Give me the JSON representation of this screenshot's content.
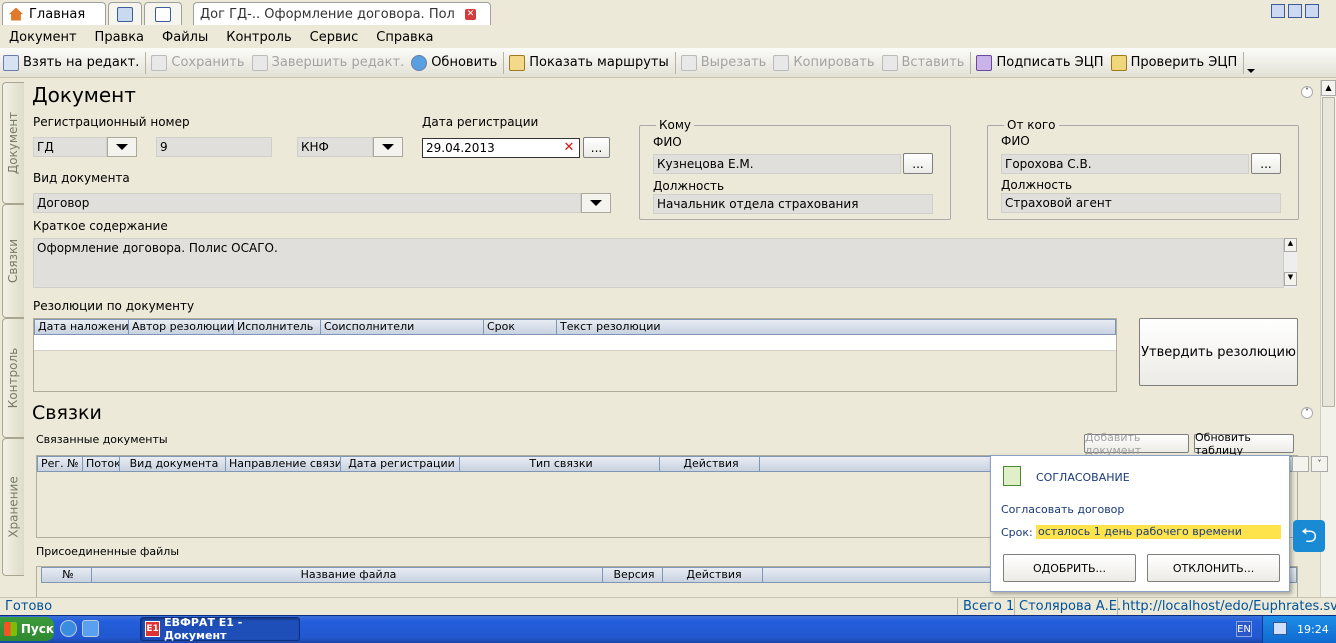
{
  "tabs": [
    {
      "label": "Главная"
    },
    {
      "label": ""
    },
    {
      "label": ""
    },
    {
      "label": "Дог ГД-..  Оформление договора. Полис..."
    }
  ],
  "menu": [
    "Документ",
    "Правка",
    "Файлы",
    "Контроль",
    "Сервис",
    "Справка"
  ],
  "toolbar": [
    {
      "label": "Взять на редакт.",
      "icon": "edit-icon",
      "enabled": true
    },
    {
      "label": "Сохранить",
      "icon": "save-icon",
      "enabled": false
    },
    {
      "label": "Завершить редакт.",
      "icon": "finish-edit-icon",
      "enabled": false
    },
    {
      "label": "Обновить",
      "icon": "refresh-icon",
      "enabled": true
    },
    {
      "label": "Показать маршруты",
      "icon": "routes-icon",
      "enabled": true
    },
    {
      "label": "Вырезать",
      "icon": "cut-icon",
      "enabled": false
    },
    {
      "label": "Копировать",
      "icon": "copy-icon",
      "enabled": false
    },
    {
      "label": "Вставить",
      "icon": "paste-icon",
      "enabled": false
    },
    {
      "label": "Подписать ЭЦП",
      "icon": "sign-icon",
      "enabled": true
    },
    {
      "label": "Проверить ЭЦП",
      "icon": "verify-sign-icon",
      "enabled": true
    }
  ],
  "sidetabs": [
    "Документ",
    "Связки",
    "Контроль",
    "Хранение"
  ],
  "document": {
    "title": "Документ",
    "reg_number_label": "Регистрационный номер",
    "reg_prefix": "ГД",
    "reg_number": "9",
    "reg_suffix": "КНФ",
    "reg_date_label": "Дата регистрации",
    "reg_date": "29.04.2013",
    "doc_type_label": "Вид документа",
    "doc_type": "Договор",
    "summary_label": "Краткое содержание",
    "summary": "Оформление договора. Полис ОСАГО.",
    "to": {
      "title": "Кому",
      "fio_label": "ФИО",
      "fio": "Кузнецова Е.М.",
      "position_label": "Должность",
      "position": "Начальник отдела страхования"
    },
    "from": {
      "title": "От кого",
      "fio_label": "ФИО",
      "fio": "Горохова С.В.",
      "position_label": "Должность",
      "position": "Страховой агент"
    },
    "resolutions_label": "Резолюции по документу",
    "resolutions_columns": [
      "Дата наложения",
      "Автор резолюции",
      "Исполнитель",
      "Соисполнители",
      "Срок",
      "Текст резолюции"
    ],
    "approve_resolution_button": "Утвердить резолюцию",
    "ellipsis": "..."
  },
  "links": {
    "title": "Связки",
    "linked_docs_label": "Связанные документы",
    "add_document_button": "Добавить документ",
    "refresh_table_button": "Обновить таблицу",
    "linked_columns": [
      "Рег. №",
      "Поток",
      "Вид документа",
      "Направление связи",
      "Дата регистрации",
      "Тип связки",
      "Действия"
    ],
    "attached_files_label": "Присоединенные файлы",
    "files_columns": [
      "№",
      "Название файла",
      "Версия",
      "Действия"
    ]
  },
  "popup": {
    "title": "СОГЛАСОВАНИЕ",
    "task": "Согласовать договор",
    "deadline_label": "Срок:",
    "deadline": "осталось 1 день рабочего времени",
    "approve_button": "ОДОБРИТЬ...",
    "reject_button": "ОТКЛОНИТЬ...",
    "highlight_color": "#ffe34d"
  },
  "status": {
    "left": "Готово",
    "total": "Всего 1",
    "user": "Столярова А.Е.",
    "url": "http://localhost/edo/Euphrates.svc/"
  },
  "taskbar": {
    "start": "Пуск",
    "window": "ЕВФРАТ Е1 - Документ",
    "lang": "EN",
    "time": "19:24"
  }
}
